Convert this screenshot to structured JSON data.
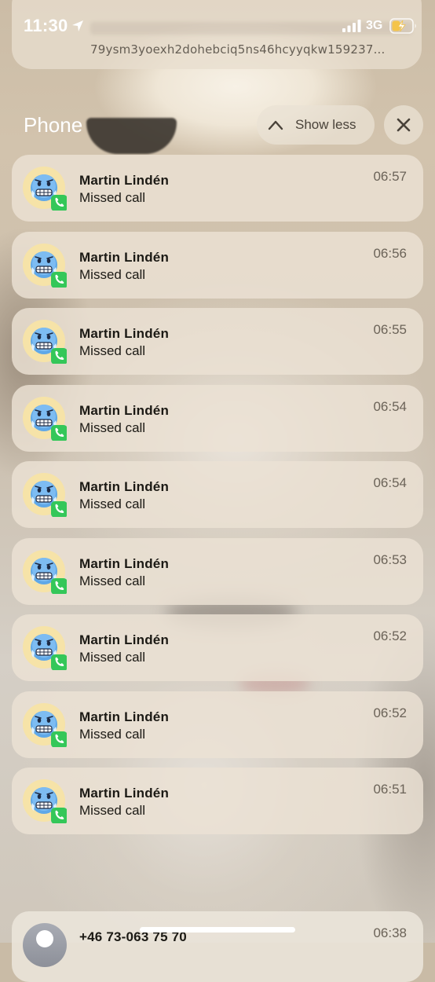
{
  "status_bar": {
    "time": "11:30",
    "network": "3G",
    "location_icon": "location-arrow-icon",
    "signal_icon": "cellular-signal-icon",
    "battery_icon": "battery-charging-icon"
  },
  "top_notification": {
    "text": "79ysm3yoexh2dohebciq5ns46hcyyqkw159237..."
  },
  "group": {
    "title": "Phone",
    "show_less_label": "Show less",
    "show_less_icon": "chevron-up-icon",
    "close_icon": "close-icon"
  },
  "notifications": [
    {
      "name": "Martin Lindén",
      "message": "Missed call",
      "time": "06:57"
    },
    {
      "name": "Martin Lindén",
      "message": "Missed call",
      "time": "06:56"
    },
    {
      "name": "Martin Lindén",
      "message": "Missed call",
      "time": "06:55"
    },
    {
      "name": "Martin Lindén",
      "message": "Missed call",
      "time": "06:54"
    },
    {
      "name": "Martin Lindén",
      "message": "Missed call",
      "time": "06:54"
    },
    {
      "name": "Martin Lindén",
      "message": "Missed call",
      "time": "06:53"
    },
    {
      "name": "Martin Lindén",
      "message": "Missed call",
      "time": "06:52"
    },
    {
      "name": "Martin Lindén",
      "message": "Missed call",
      "time": "06:52"
    },
    {
      "name": "Martin Lindén",
      "message": "Missed call",
      "time": "06:51"
    }
  ],
  "bottom_notification": {
    "name": "+46 73-063 75 70",
    "time": "06:38"
  },
  "avatar_icon": "cold-face-emoji-icon",
  "app_badge_icon": "phone-app-icon",
  "colors": {
    "phone_green": "#34c759",
    "emoji_blue": "#5fa8e8",
    "emoji_yellow_bg": "#f6e3a8"
  }
}
